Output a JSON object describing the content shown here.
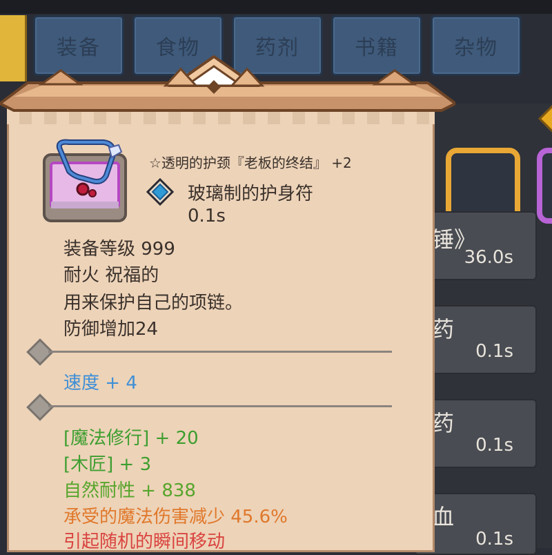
{
  "tabs": [
    {
      "label": "装备"
    },
    {
      "label": "食物"
    },
    {
      "label": "药剂"
    },
    {
      "label": "书籍"
    },
    {
      "label": "杂物"
    }
  ],
  "background_list": {
    "rows": [
      {
        "fragment": "锤》",
        "time": "36.0s"
      },
      {
        "fragment": "药",
        "time": "0.1s"
      },
      {
        "fragment": "药",
        "time": "0.1s"
      },
      {
        "fragment": "血",
        "time": "0.1s"
      }
    ]
  },
  "tooltip": {
    "name_line": "☆透明的护颈『老板的终结』 +2",
    "item_type": "玻璃制的护身符",
    "cast_time": "0.1s",
    "equip_level": "装备等级 999",
    "traits": "耐火  祝福的",
    "description": "用来保护自己的项链。",
    "defense": "防御增加24",
    "speed": "速度 + 4",
    "bonuses": [
      {
        "text": "[魔法修行] + 20",
        "color": "#3d9e2f"
      },
      {
        "text": "[木匠] + 3",
        "color": "#3d9e2f"
      },
      {
        "text": "自然耐性 + 838",
        "color": "#56a52c"
      },
      {
        "text": "承受的魔法伤害减少 45.6%",
        "color": "#e0782b"
      },
      {
        "text": "引起随机的瞬间移动",
        "color": "#d9433f"
      }
    ]
  },
  "colors": {
    "speed": "#3e8fd6",
    "panel": "#edd3b8",
    "tab": "#3f5a7a"
  }
}
